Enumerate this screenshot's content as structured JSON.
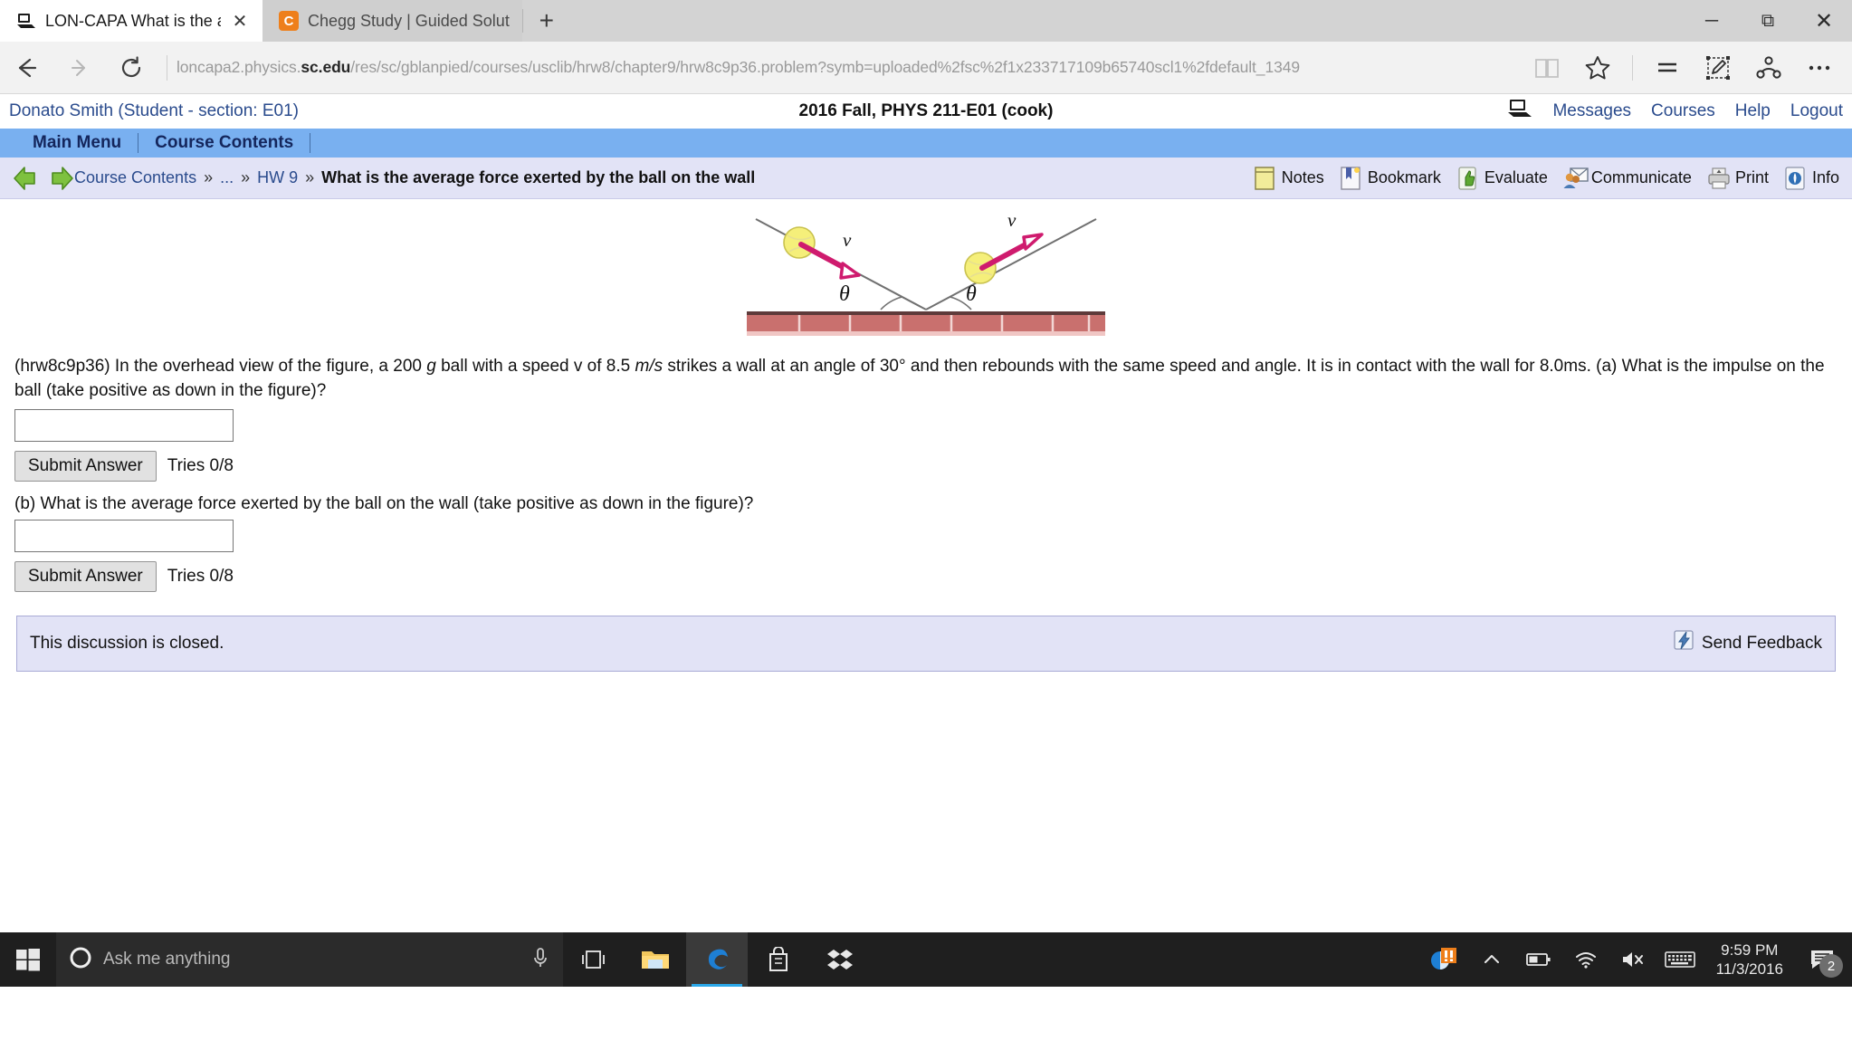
{
  "browser": {
    "tabs": [
      {
        "title": "LON-CAPA What is the a",
        "favicon": "loncapa-icon",
        "active": true,
        "close_label": "✕"
      },
      {
        "title": "Chegg Study | Guided Solut",
        "favicon": "chegg-icon",
        "active": false,
        "letter": "C"
      }
    ],
    "new_tab_label": "+",
    "window_controls": {
      "minimize": "─",
      "restore": "⧉",
      "close": "✕"
    },
    "url": {
      "prefix": "loncapa2.physics.",
      "domain": "sc.edu",
      "path": "/res/sc/gblanpied/courses/usclib/hrw8/chapter9/hrw8c9p36.problem?symb=uploaded%2fsc%2f1x233717109b65740scl1%2fdefault_1349"
    },
    "nav": {
      "back": "back-arrow-icon",
      "forward": "forward-arrow-icon",
      "refresh": "refresh-icon",
      "reading_view": "reading-view-icon",
      "favorite": "star-icon",
      "hub": "hub-icon",
      "web_note": "web-note-icon",
      "share": "share-icon",
      "more": "more-icon"
    }
  },
  "loncapa": {
    "user": "Donato Smith (Student  - section: E01)",
    "course": "2016 Fall, PHYS 211-E01 (cook)",
    "remote_icon": "remote-control-icon",
    "links": [
      "Messages",
      "Courses",
      "Help",
      "Logout"
    ],
    "menu": [
      "Main Menu",
      "Course Contents"
    ],
    "breadcrumb": {
      "back_icon": "green-left-arrow-icon",
      "forward_icon": "green-right-arrow-icon",
      "items": [
        "Course Contents",
        "...",
        "HW 9"
      ],
      "separator": "»",
      "current": "What is the average force exerted by the ball on the wall"
    },
    "tools": [
      {
        "label": "Notes",
        "icon": "notes-icon"
      },
      {
        "label": "Bookmark",
        "icon": "bookmark-icon"
      },
      {
        "label": "Evaluate",
        "icon": "thumbs-up-icon"
      },
      {
        "label": "Communicate",
        "icon": "communicate-icon"
      },
      {
        "label": "Print",
        "icon": "printer-icon"
      },
      {
        "label": "Info",
        "icon": "info-icon"
      }
    ]
  },
  "figure": {
    "alt": "Overhead view: ball strikes wall at angle theta and rebounds at angle theta",
    "angle_label": "θ",
    "velocity_label": "v",
    "wall_color": "#c9706e",
    "ball_color": "#f5ef7a",
    "vector_color": "#cf1b6e"
  },
  "problem": {
    "id": "(hrw8c9p36)",
    "text_1": " In the overhead view of the figure, a 200 ",
    "unit_g": "g",
    "text_2": " ball with a speed v of 8.5 ",
    "unit_ms": "m/s",
    "text_3": " strikes a wall at an angle of 30° and then rebounds with the same speed and angle. It is in contact with the wall for 8.0ms. (a) What is the impulse on the ball (take positive as down in the figure)?",
    "part_b": "(b) What is the average force exerted by the ball on the wall (take positive as down in the figure)?",
    "answer_a": "",
    "answer_b": "",
    "submit_label": "Submit Answer",
    "tries_a": "Tries 0/8",
    "tries_b": "Tries 0/8"
  },
  "discussion": {
    "status": "This discussion is closed.",
    "feedback_label": "Send Feedback",
    "feedback_icon": "feedback-icon"
  },
  "taskbar": {
    "start_icon": "windows-start-icon",
    "search_placeholder": "Ask me anything",
    "cortana_icon": "cortana-circle-icon",
    "mic_icon": "microphone-icon",
    "taskview_icon": "task-view-icon",
    "apps": [
      {
        "name": "file-explorer-icon",
        "active": false
      },
      {
        "name": "edge-icon",
        "active": true
      },
      {
        "name": "store-icon",
        "active": false
      },
      {
        "name": "dropbox-icon",
        "active": false
      }
    ],
    "tray": [
      {
        "name": "app-tray-icon"
      },
      {
        "name": "show-hidden-icons-icon"
      },
      {
        "name": "battery-icon"
      },
      {
        "name": "wifi-icon"
      },
      {
        "name": "volume-muted-icon"
      },
      {
        "name": "keyboard-icon"
      }
    ],
    "time": "9:59 PM",
    "date": "11/3/2016",
    "action_center_icon": "action-center-icon",
    "notification_count": "2"
  },
  "colors": {
    "menubar_blue": "#79b0f0",
    "crumb_lavender": "#e2e3f6",
    "link_blue": "#2a4b8d",
    "taskbar_dark": "#1f1f1f"
  }
}
